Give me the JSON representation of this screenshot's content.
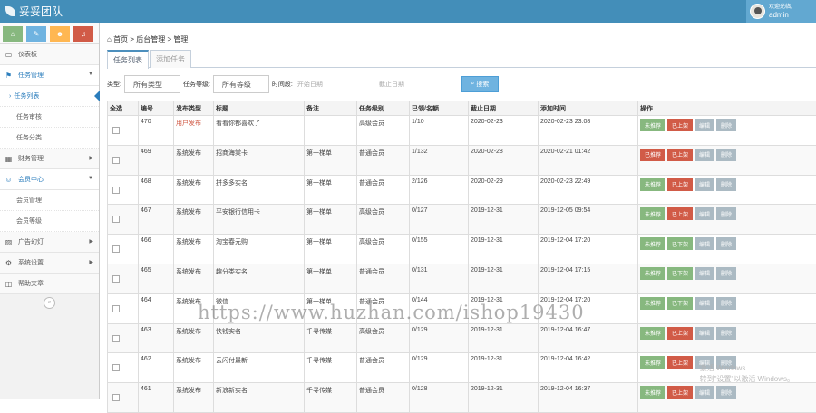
{
  "topbar": {
    "brand": "妥妥团队",
    "user_welcome": "欢迎光临,",
    "user_name": "admin"
  },
  "sidebar": {
    "shortcuts": [
      {
        "icon": "home-icon",
        "color": "#87b87f",
        "glyph": "⌂"
      },
      {
        "icon": "pencil-icon",
        "color": "#6fb3e0",
        "glyph": "✎"
      },
      {
        "icon": "users-icon",
        "color": "#ffb752",
        "glyph": "☻"
      },
      {
        "icon": "bell-icon",
        "color": "#d15b47",
        "glyph": "♫"
      }
    ],
    "items": [
      {
        "label": "仪表板",
        "icon": "monitor-icon",
        "glyph": "▭"
      },
      {
        "label": "任务管理",
        "icon": "flag-icon",
        "glyph": "⚑",
        "open": true,
        "subs": [
          {
            "label": "任务列表",
            "active": true
          },
          {
            "label": "任务审核"
          },
          {
            "label": "任务分类"
          }
        ]
      },
      {
        "label": "财务管理",
        "icon": "grid-icon",
        "glyph": "▦"
      },
      {
        "label": "会员中心",
        "icon": "user-icon",
        "glyph": "☺",
        "open": true,
        "subs": [
          {
            "label": "会员管理"
          },
          {
            "label": "会员等级"
          }
        ]
      },
      {
        "label": "广告幻灯",
        "icon": "picture-icon",
        "glyph": "▨"
      },
      {
        "label": "系统设置",
        "icon": "cog-icon",
        "glyph": "⚙"
      },
      {
        "label": "帮助文章",
        "icon": "bookmark-icon",
        "glyph": "◫"
      }
    ],
    "collapse": "«"
  },
  "breadcrumb": {
    "home": "首页",
    "sep": ">",
    "level1": "后台管理",
    "level2": "管理"
  },
  "tabs": [
    "任务列表",
    "添加任务"
  ],
  "filters": {
    "type_label": "类型:",
    "type_value": "所有类型",
    "level_label": "任务等级:",
    "level_value": "所有等级",
    "date_label": "时间段:",
    "date_start": "开始日期",
    "date_end": "截止日期",
    "search": "搜索"
  },
  "table": {
    "headers": [
      "全选",
      "编号",
      "发布类型",
      "标题",
      "备注",
      "任务级别",
      "已领/名额",
      "截止日期",
      "添加时间",
      "操作"
    ],
    "rows": [
      {
        "id": "470",
        "pubtype": "用户发布",
        "pubtype_red": true,
        "title": "看看你都喜欢了",
        "note": "",
        "level": "高级会员",
        "quota": "1/10",
        "deadline": "2020-02-23",
        "added": "2020-02-23 23:08",
        "ops": [
          [
            "未推荐",
            "g"
          ],
          [
            "已上架",
            "r"
          ],
          [
            "编辑",
            "gray"
          ],
          [
            "删除",
            "gray"
          ]
        ]
      },
      {
        "id": "469",
        "pubtype": "系统发布",
        "title": "招商海棠卡",
        "note": "第一梯单",
        "level": "普通会员",
        "quota": "1/132",
        "deadline": "2020-02-28",
        "added": "2020-02-21 01:42",
        "ops": [
          [
            "已推荐",
            "r"
          ],
          [
            "已上架",
            "r"
          ],
          [
            "编辑",
            "gray"
          ],
          [
            "删除",
            "gray"
          ]
        ]
      },
      {
        "id": "468",
        "pubtype": "系统发布",
        "title": "拼多多实名",
        "note": "第一梯单",
        "level": "普通会员",
        "quota": "2/126",
        "deadline": "2020-02-29",
        "added": "2020-02-23 22:49",
        "ops": [
          [
            "未推荐",
            "g"
          ],
          [
            "已上架",
            "r"
          ],
          [
            "编辑",
            "gray"
          ],
          [
            "删除",
            "gray"
          ]
        ]
      },
      {
        "id": "467",
        "pubtype": "系统发布",
        "title": "平安银行信用卡",
        "note": "第一梯单",
        "level": "高级会员",
        "quota": "0/127",
        "deadline": "2019-12-31",
        "added": "2019-12-05 09:54",
        "ops": [
          [
            "未推荐",
            "g"
          ],
          [
            "已上架",
            "r"
          ],
          [
            "编辑",
            "gray"
          ],
          [
            "删除",
            "gray"
          ]
        ]
      },
      {
        "id": "466",
        "pubtype": "系统发布",
        "title": "淘宝春元购",
        "note": "第一梯单",
        "level": "高级会员",
        "quota": "0/155",
        "deadline": "2019-12-31",
        "added": "2019-12-04 17:20",
        "ops": [
          [
            "未推荐",
            "g"
          ],
          [
            "已下架",
            "g"
          ],
          [
            "编辑",
            "gray"
          ],
          [
            "删除",
            "gray"
          ]
        ]
      },
      {
        "id": "465",
        "pubtype": "系统发布",
        "title": "趣分类实名",
        "note": "第一梯单",
        "level": "普通会员",
        "quota": "0/131",
        "deadline": "2019-12-31",
        "added": "2019-12-04 17:15",
        "ops": [
          [
            "未推荐",
            "g"
          ],
          [
            "已下架",
            "g"
          ],
          [
            "编辑",
            "gray"
          ],
          [
            "删除",
            "gray"
          ]
        ]
      },
      {
        "id": "464",
        "pubtype": "系统发布",
        "title": "微信",
        "note": "第一梯单",
        "level": "普通会员",
        "quota": "0/144",
        "deadline": "2019-12-31",
        "added": "2019-12-04 17:20",
        "ops": [
          [
            "未推荐",
            "g"
          ],
          [
            "已下架",
            "g"
          ],
          [
            "编辑",
            "gray"
          ],
          [
            "删除",
            "gray"
          ]
        ]
      },
      {
        "id": "463",
        "pubtype": "系统发布",
        "title": "快钱实名",
        "note": "千寻传媒",
        "level": "高级会员",
        "quota": "0/129",
        "deadline": "2019-12-31",
        "added": "2019-12-04 16:47",
        "ops": [
          [
            "未推荐",
            "g"
          ],
          [
            "已上架",
            "r"
          ],
          [
            "编辑",
            "gray"
          ],
          [
            "删除",
            "gray"
          ]
        ]
      },
      {
        "id": "462",
        "pubtype": "系统发布",
        "title": "云闪付最新",
        "note": "千寻传媒",
        "level": "普通会员",
        "quota": "0/129",
        "deadline": "2019-12-31",
        "added": "2019-12-04 16:42",
        "ops": [
          [
            "未推荐",
            "g"
          ],
          [
            "已上架",
            "r"
          ],
          [
            "编辑",
            "gray"
          ],
          [
            "删除",
            "gray"
          ]
        ]
      },
      {
        "id": "461",
        "pubtype": "系统发布",
        "title": "新浪新实名",
        "note": "千寻传媒",
        "level": "普通会员",
        "quota": "0/128",
        "deadline": "2019-12-31",
        "added": "2019-12-04 16:37",
        "ops": [
          [
            "未推荐",
            "g"
          ],
          [
            "已上架",
            "r"
          ],
          [
            "编辑",
            "gray"
          ],
          [
            "删除",
            "gray"
          ]
        ]
      }
    ]
  },
  "watermark": "https://www.huzhan.com/ishop19430",
  "activation": {
    "line1": "激活 Windows",
    "line2": "转到\"设置\"以激活 Windows。"
  }
}
